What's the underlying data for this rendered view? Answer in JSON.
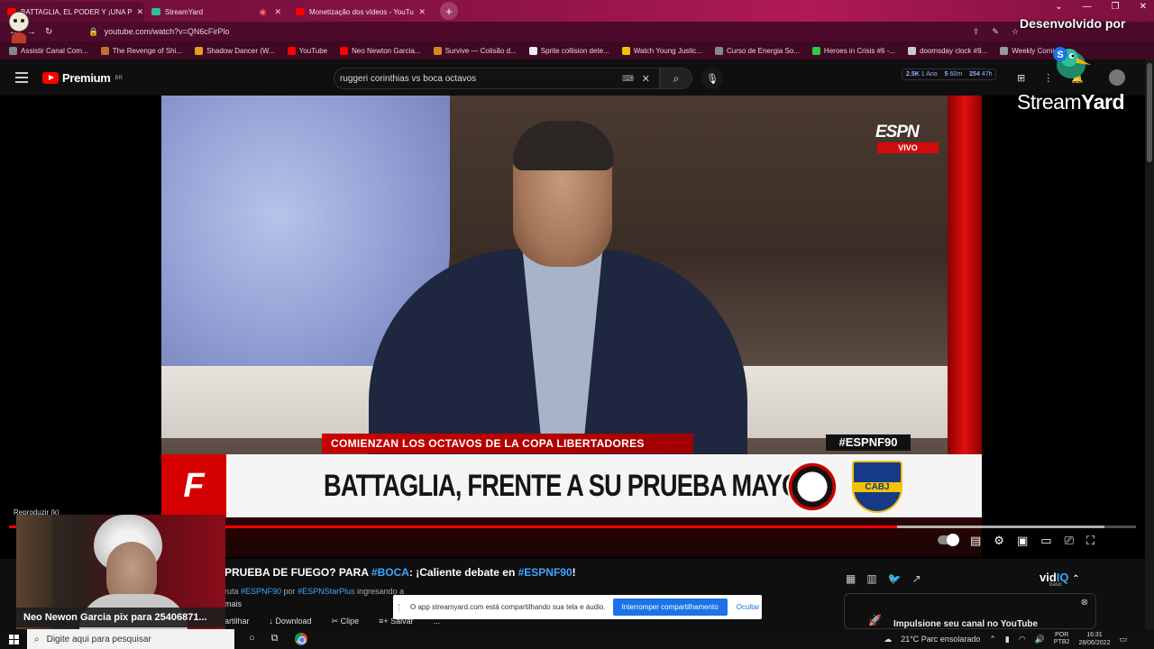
{
  "browser": {
    "tabs": [
      {
        "label": "BATTAGLIA, EL PODER Y ¡UNA P",
        "icon": "youtube-icon",
        "color": "#ff0000"
      },
      {
        "label": "StreamYard",
        "icon": "streamyard-icon",
        "color": "#2bbf9a"
      },
      {
        "label": "Monetização dos vídeos - YouTu",
        "icon": "youtube-icon",
        "color": "#ff0000"
      }
    ],
    "new_tab": "+",
    "url": "youtube.com/watch?v=QN6cFirPlo",
    "bookmarks": [
      "Assistir Canal Com...",
      "The Revenge of Shi...",
      "Shadow Dancer (W...",
      "YouTube",
      "Neo Newton Garcia...",
      "Survive — Colisão d...",
      "Sprite collision dete...",
      "Watch Young Justic...",
      "Curso de Energia So...",
      "Heroes in Crisis #6 -...",
      "doomsday clock #9...",
      "Weekly Comic"
    ]
  },
  "youtube": {
    "logo_text": "Premium",
    "logo_sup": "BR",
    "search_value": "ruggeri corinthias vs boca octavos",
    "stats": {
      "views": "2.5K",
      "views_sub": "1 Ano",
      "likes": "5",
      "likes_sub": "60m",
      "other": "254",
      "other_sub": "47h"
    },
    "video": {
      "channel_badge": "ESPN",
      "live_badge": "VIVO",
      "hashtag": "#ESPNF90",
      "subheadline": "COMIENZAN LOS OCTAVOS DE LA COPA LIBERTADORES",
      "show_logo": "F 90",
      "headline": "BATTAGLIA, FRENTE A SU PRUEBA MAYOR",
      "crest_right": "CABJ",
      "tooltip": "Reproduzir (k)",
      "progress_played": 0.788,
      "progress_loaded": 0.972
    },
    "title": {
      "pre": "PRUEBA DE FUEGO? PARA ",
      "tag1": "#BOCA",
      "mid": ": ¡Caliente debate en ",
      "tag2": "#ESPNF90",
      "post": "!"
    },
    "meta": {
      "pre": "ruta ",
      "tag1": "#ESPNF90",
      "mid": " por ",
      "tag2": "#ESPNStarPlus",
      "post": " ingresando a"
    },
    "more": "mais",
    "actions": [
      "artilhar",
      "Download",
      "Clipe",
      "Salvar",
      "..."
    ],
    "vidiq": {
      "logo_a": "vid",
      "logo_b": "IQ",
      "sub": "basic",
      "promo": "Impulsione seu canal no YouTube"
    }
  },
  "share_banner": {
    "message": "O app streamyard.com está compartilhando sua tela e áudio.",
    "stop": "Interromper compartilhamento",
    "hide": "Ocultar"
  },
  "overlay": {
    "developed_by": "Desenvolvido por",
    "brand_a": "Stream",
    "brand_b": "Yard",
    "cam_label": "Neo Newon Garcia pix para 25406871..."
  },
  "taskbar": {
    "search_placeholder": "Digite aqui para pesquisar",
    "weather": "21°C  Parc ensolarado",
    "lang_a": "POR",
    "lang_b": "PTB2",
    "time": "16:31",
    "date": "28/06/2022"
  }
}
